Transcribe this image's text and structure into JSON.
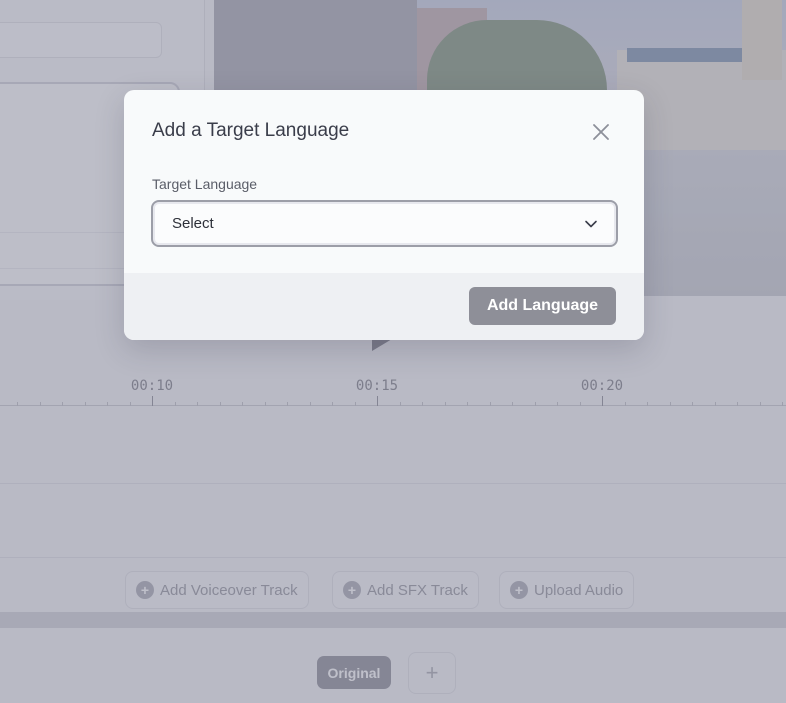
{
  "timeline": {
    "ticks": [
      "00:10",
      "00:15",
      "00:20"
    ]
  },
  "tracks": {
    "add_voiceover_label": "Add Voiceover Track",
    "add_sfx_label": "Add SFX Track",
    "upload_audio_label": "Upload Audio"
  },
  "bottom": {
    "original_label": "Original",
    "add_icon": "+"
  },
  "modal": {
    "title": "Add a Target Language",
    "field_label": "Target Language",
    "select_value": "Select",
    "submit_label": "Add Language"
  },
  "colors": {
    "overlay": "#666880",
    "primary_button": "#8e8f98",
    "modal_bg": "#f8fafb",
    "footer_bg": "#eef0f3"
  },
  "icons": {
    "close": "close-icon",
    "chevron": "chevron-down-icon",
    "play": "play-icon",
    "add": "plus-circle-icon"
  }
}
